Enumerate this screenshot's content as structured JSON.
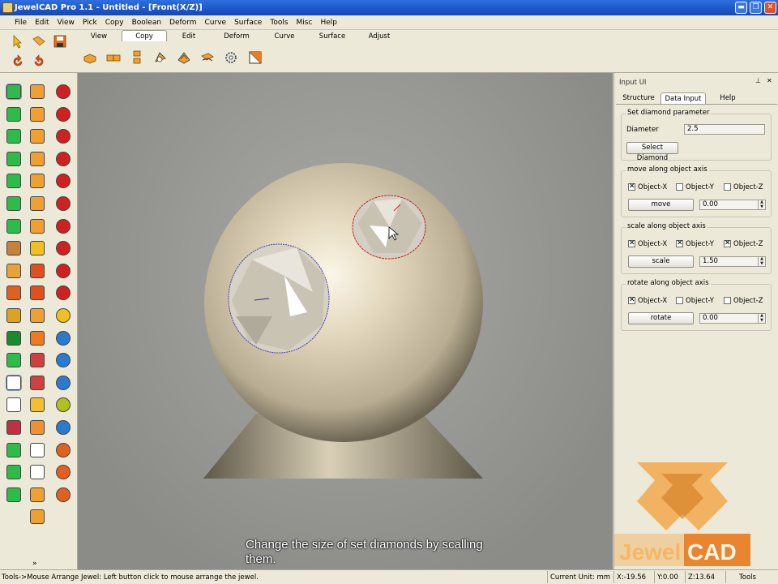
{
  "window": {
    "title": "JewelCAD Pro 1.1 - Untitled - [Front(X/Z)]",
    "min_glyph": "▬",
    "max_glyph": "❐",
    "close_glyph": "✕"
  },
  "menu": [
    "File",
    "Edit",
    "View",
    "Pick",
    "Copy",
    "Boolean",
    "Deform",
    "Curve",
    "Surface",
    "Tools",
    "Misc",
    "Help"
  ],
  "toolbar_tabs": [
    {
      "label": "View",
      "active": false
    },
    {
      "label": "Copy",
      "active": true
    },
    {
      "label": "Edit",
      "active": false
    },
    {
      "label": "Deform",
      "active": false
    },
    {
      "label": "Curve",
      "active": false
    },
    {
      "label": "Surface",
      "active": false
    },
    {
      "label": "Adjust",
      "active": false
    }
  ],
  "left_toolbar_expand_glyph": "»",
  "panel": {
    "title": "Input UI",
    "pin_glyph": "⊥",
    "close_glyph": "✕",
    "tabs": [
      {
        "label": "Structure",
        "active": false
      },
      {
        "label": "Data Input",
        "active": true
      },
      {
        "label": "Help",
        "active": false
      }
    ],
    "diamond": {
      "group_label": "Set diamond parameter",
      "diameter_label": "Diameter",
      "diameter_value": "2.5",
      "select_button": "Select Diamond"
    },
    "move": {
      "group_label": "move along object axis",
      "axes": [
        {
          "label": "Object-X",
          "checked": true
        },
        {
          "label": "Object-Y",
          "checked": false
        },
        {
          "label": "Object-Z",
          "checked": false
        }
      ],
      "button": "move",
      "value": "0.00"
    },
    "scale": {
      "group_label": "scale along object axis",
      "axes": [
        {
          "label": "Object-X",
          "checked": true
        },
        {
          "label": "Object-Y",
          "checked": true
        },
        {
          "label": "Object-Z",
          "checked": true
        }
      ],
      "button": "scale",
      "value": "1.50"
    },
    "rotate": {
      "group_label": "rotate along object axis",
      "axes": [
        {
          "label": "Object-X",
          "checked": true
        },
        {
          "label": "Object-Y",
          "checked": false
        },
        {
          "label": "Object-Z",
          "checked": false
        }
      ],
      "button": "rotate",
      "value": "0.00"
    }
  },
  "logo": {
    "word1": "Jewel",
    "word2": "CAD"
  },
  "subtitle": {
    "line1": "Change the size of set diamonds by scalling",
    "line2": "them."
  },
  "status": {
    "message": "Tools->Mouse Arrange Jewel: Left button click to mouse arrange the jewel.",
    "unit": "Current Unit:  mm",
    "x": "X:-19.56",
    "y": "Y:0.00",
    "z": "Z:13.64",
    "extra": "Tools"
  },
  "colors": {
    "accent": "#2f6fe0",
    "viewport": "#9a9b98",
    "model": "#d8ccb0",
    "logo_orange": "#f0962e"
  }
}
